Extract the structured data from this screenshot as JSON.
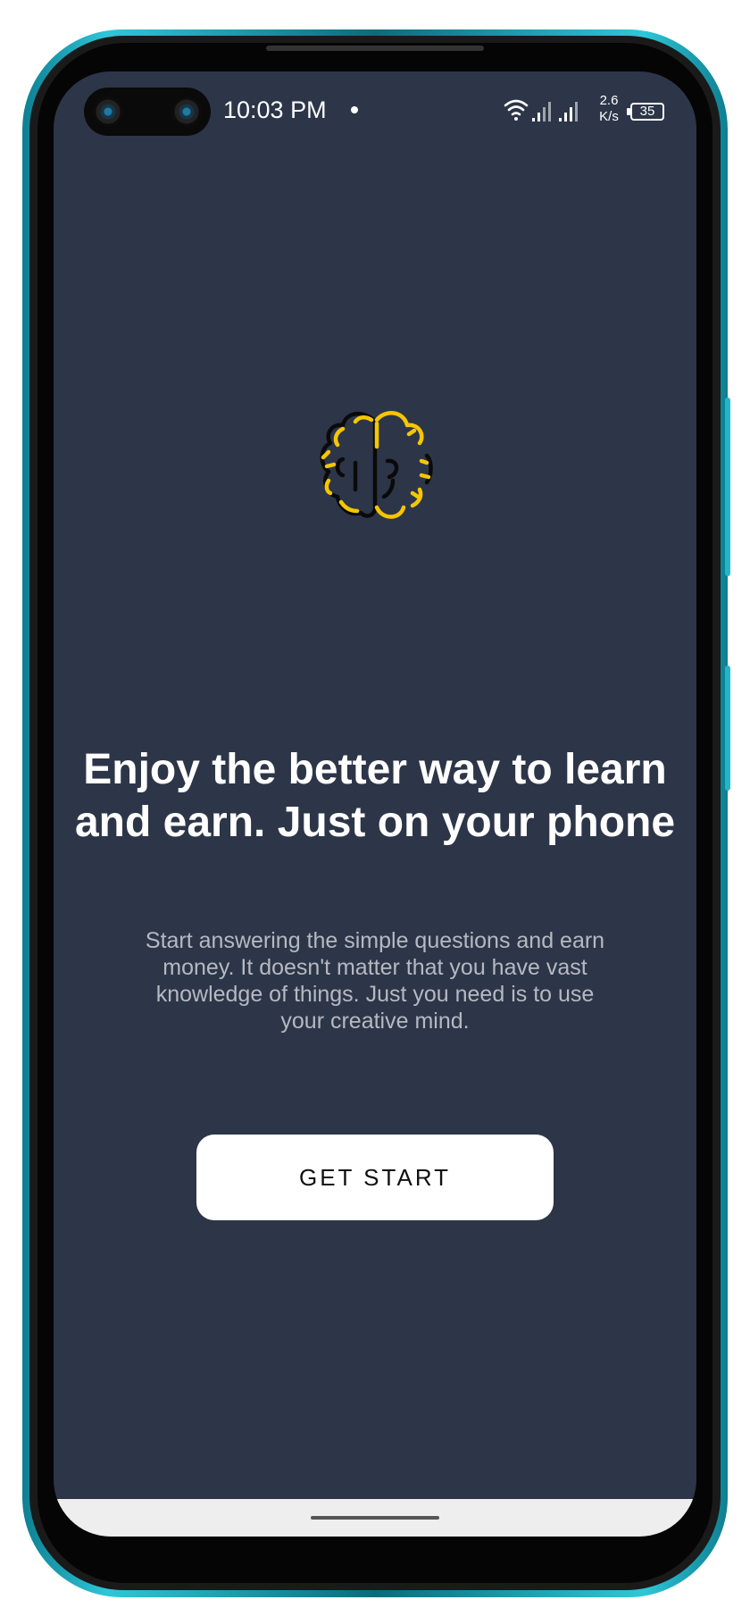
{
  "status_bar": {
    "time": "10:03 PM",
    "network_speed_value": "2.6",
    "network_speed_unit": "K/s",
    "battery_level": "35",
    "icons": [
      "wifi-icon",
      "signal-icon",
      "signal-icon",
      "battery-icon"
    ]
  },
  "onboarding": {
    "logo_icon": "brain-icon",
    "headline": "Enjoy the better way to learn and earn. Just on your phone",
    "description": "Start answering the simple questions and earn money. It doesn't matter that you have vast knowledge of things. Just you need is to use your creative mind.",
    "primary_button_label": "GET START"
  },
  "colors": {
    "background": "#2d3648",
    "accent_yellow": "#f6c600",
    "button_bg": "#ffffff",
    "frame_teal": "#1fb3c6"
  }
}
